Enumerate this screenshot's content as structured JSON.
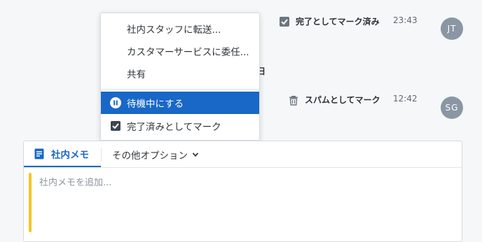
{
  "timeline": {
    "events": [
      {
        "text": "完了としてマーク済み",
        "time": "23:43",
        "avatar": "JT",
        "icon": "checkbox-checked-icon"
      },
      {
        "text": "スパムとしてマーク",
        "time": "12:42",
        "avatar": "SG",
        "icon": "trash-icon"
      }
    ],
    "date_fragment": "曜日"
  },
  "menu": {
    "items": [
      {
        "label": "社内スタッフに転送..."
      },
      {
        "label": "カスタマーサービスに委任..."
      },
      {
        "label": "共有"
      },
      {
        "label": "待機中にする",
        "icon": "pause-icon",
        "active": true
      },
      {
        "label": "完了済みとしてマーク",
        "icon": "checkbox-checked-icon"
      }
    ]
  },
  "composer": {
    "tab_notes": "社内メモ",
    "tab_more": "その他オプション",
    "placeholder": "社内メモを追加..."
  },
  "colors": {
    "accent": "#1967c7",
    "note_bar": "#f3c624",
    "avatar": "#8a96a3"
  }
}
